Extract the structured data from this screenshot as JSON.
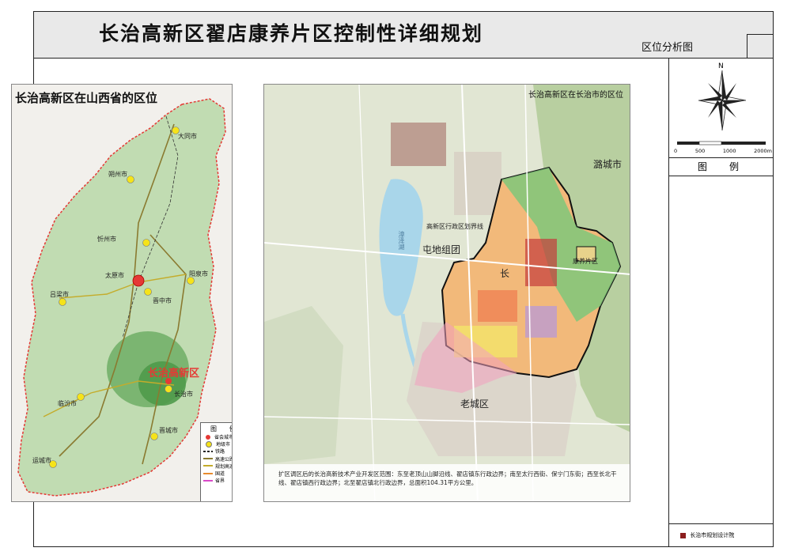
{
  "header": {
    "title": "长治高新区翟店康养片区控制性详细规划",
    "subtitle": "区位分析图"
  },
  "sidebar": {
    "north_label": "N",
    "scale_labels": [
      "0",
      "500",
      "1000",
      "2000m"
    ],
    "legend_title": "图　例",
    "footer_text": "长治市规划设计院"
  },
  "left_map": {
    "title": "长治高新区在山西省的区位",
    "cities": [
      {
        "name": "大同市"
      },
      {
        "name": "朔州市"
      },
      {
        "name": "忻州市"
      },
      {
        "name": "太原市"
      },
      {
        "name": "阳泉市"
      },
      {
        "name": "吕梁市"
      },
      {
        "name": "晋中市"
      },
      {
        "name": "临汾市"
      },
      {
        "name": "长治市"
      },
      {
        "name": "晋城市"
      },
      {
        "name": "运城市"
      }
    ],
    "highlight_label": "长治高新区",
    "legend": {
      "title": "图　例",
      "items": [
        "省会城市",
        "地级市",
        "铁路",
        "高速公路",
        "规划高速公路",
        "国道",
        "省界"
      ]
    },
    "colors": {
      "province_fill": "#b9d7a8",
      "highlight": "#4f9a4a",
      "border": "#e53935",
      "city": "#f5e31a"
    }
  },
  "right_map": {
    "title": "长治高新区在长治市的区位",
    "labels": {
      "lake": "漳泽湖",
      "district_admin": "高新区行政区划界线",
      "tundi": "屯地组团",
      "chang": "长",
      "kangyang": "康养片区",
      "luancheng": "潞城市",
      "old_city": "老城区"
    },
    "caption": "扩区调区后的长治高新技术产业开发区范围：东至老顶山山脚沿线、翟店镇东行政边界；南至太行西街、保宁门东街；西至长北干线、翟店镇西行政边界；北至翟店镇北行政边界，总面积104.31平方公里。"
  }
}
